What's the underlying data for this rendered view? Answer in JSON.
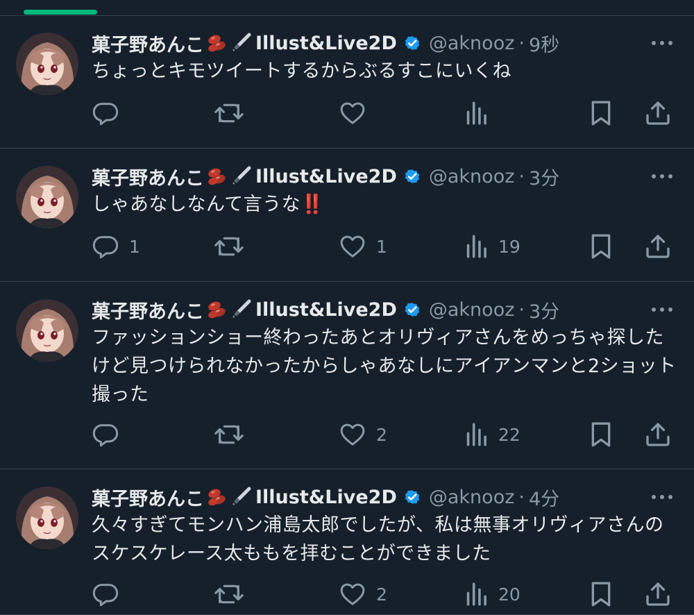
{
  "colors": {
    "background": "#15202b",
    "text": "#e7e9ea",
    "muted": "#8b98a5",
    "accent_tab": "#00ba7c",
    "verified": "#1d9bf0",
    "divider": "#38444d"
  },
  "tweets": [
    {
      "name": "菓子野あんこ",
      "name_suffix": "Illust&Live2D",
      "handle": "@aknooz",
      "dot": "·",
      "time": "9秒",
      "text": "ちょっとキモツイートするからぶるすこにいくね",
      "reply_count": "",
      "retweet_count": "",
      "like_count": "",
      "view_count": ""
    },
    {
      "name": "菓子野あんこ",
      "name_suffix": "Illust&Live2D",
      "handle": "@aknooz",
      "dot": "·",
      "time": "3分",
      "text": "しゃあなしなんて言うな‼️",
      "reply_count": "1",
      "retweet_count": "",
      "like_count": "1",
      "view_count": "19"
    },
    {
      "name": "菓子野あんこ",
      "name_suffix": "Illust&Live2D",
      "handle": "@aknooz",
      "dot": "·",
      "time": "3分",
      "text": "ファッションショー終わったあとオリヴィアさんをめっちゃ探したけど見つけられなかったからしゃあなしにアイアンマンと2ショット撮った",
      "reply_count": "",
      "retweet_count": "",
      "like_count": "2",
      "view_count": "22"
    },
    {
      "name": "菓子野あんこ",
      "name_suffix": "Illust&Live2D",
      "handle": "@aknooz",
      "dot": "·",
      "time": "4分",
      "text": "久々すぎてモンハン浦島太郎でしたが、私は無事オリヴィアさんのスケスケレース太ももを拝むことができました",
      "reply_count": "",
      "retweet_count": "",
      "like_count": "2",
      "view_count": "20"
    }
  ],
  "icons": {
    "emoji1": "beans-emoji",
    "emoji2": "fountain-pen-emoji",
    "verified": "verified-badge-icon",
    "more": "more-dots-icon",
    "reply": "reply-icon",
    "retweet": "retweet-icon",
    "like": "heart-icon",
    "views": "views-chart-icon",
    "bookmark": "bookmark-icon",
    "share": "share-icon"
  }
}
